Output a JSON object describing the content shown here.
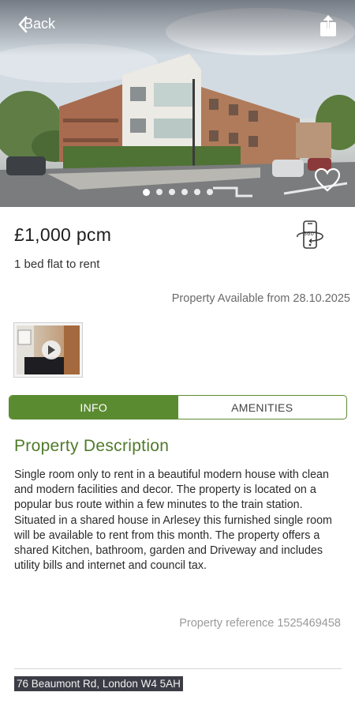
{
  "header": {
    "back_label": "Back",
    "icons": {
      "back": "chevron-left-icon",
      "share": "share-icon",
      "favourite": "heart-icon"
    }
  },
  "gallery": {
    "image_count": 6,
    "active_index": 0
  },
  "listing": {
    "price": "£1,000 pcm",
    "subtitle": "1 bed flat to rent",
    "availability": "Property Available from 28.10.2025",
    "vr_icon_label": "360°"
  },
  "tabs": [
    {
      "label": "INFO",
      "active": true
    },
    {
      "label": "AMENITIES",
      "active": false
    }
  ],
  "description": {
    "title": "Property Description",
    "body": "Single room only to rent in a beautiful modern house with clean and modern facilities and decor. The property is located on a popular bus route within a few minutes to the train station. Situated in a shared house in Arlesey this furnished single room will be available to rent from this month. The property offers a shared Kitchen, bathroom, garden and Driveway and includes utility bills and internet and council tax."
  },
  "reference": "Property reference 1525469458",
  "address": "76 Beaumont Rd, London W4 5AH",
  "colors": {
    "accent": "#5b8b31",
    "title_green": "#4f7a2a"
  }
}
